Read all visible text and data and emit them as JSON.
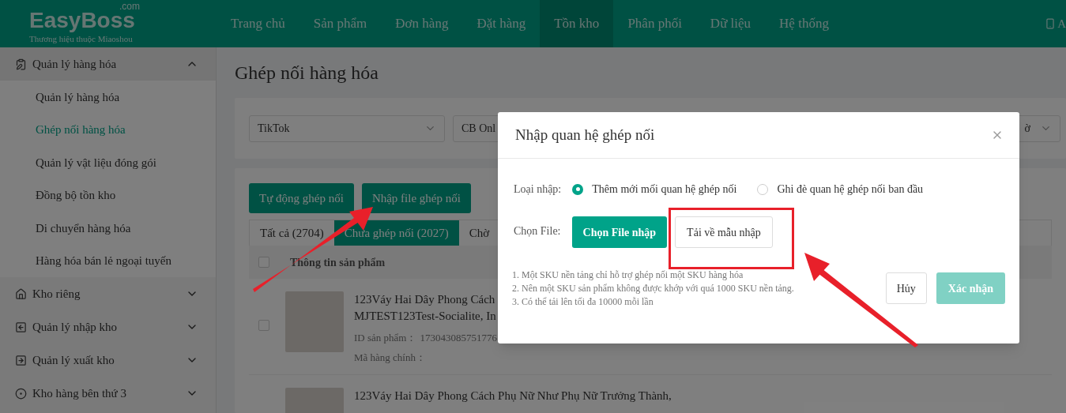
{
  "header": {
    "logo": "EasyBoss",
    "logo_suffix": ".com",
    "tagline": "Thương hiệu thuộc Miaoshou",
    "nav": [
      {
        "label": "Trang chủ",
        "selected": false
      },
      {
        "label": "Sản phẩm",
        "selected": false
      },
      {
        "label": "Đơn hàng",
        "selected": false
      },
      {
        "label": "Đặt hàng",
        "selected": false
      },
      {
        "label": "Tồn kho",
        "selected": true
      },
      {
        "label": "Phân phối",
        "selected": false
      },
      {
        "label": "Dữ liệu",
        "selected": false
      },
      {
        "label": "Hệ thống",
        "selected": false
      }
    ],
    "right_label": "A"
  },
  "sidebar": [
    {
      "kind": "clipboard",
      "label": "Quản lý hàng hóa",
      "expanded": true,
      "children": [
        {
          "label": "Quản lý hàng hóa",
          "selected": false
        },
        {
          "label": "Ghép nối hàng hóa",
          "selected": true
        },
        {
          "label": "Quản lý vật liệu đóng gói",
          "selected": false
        },
        {
          "label": "Đồng bộ tồn kho",
          "selected": false
        },
        {
          "label": "Di chuyển hàng hóa",
          "selected": false
        },
        {
          "label": "Hàng hóa bán lẻ ngoại tuyến",
          "selected": false
        }
      ]
    },
    {
      "kind": "house",
      "label": "Kho riêng",
      "expanded": false
    },
    {
      "kind": "inbound",
      "label": "Quản lý nhập kho",
      "expanded": false
    },
    {
      "kind": "outbound",
      "label": "Quản lý xuất kho",
      "expanded": false
    },
    {
      "kind": "thirdparty",
      "label": "Kho hàng bên thứ 3",
      "expanded": false
    }
  ],
  "page_title": "Ghép nối hàng hóa",
  "filters": [
    {
      "value": "TikTok"
    },
    {
      "value": "CB Onl"
    },
    {
      "value": "ờ"
    }
  ],
  "actions": [
    "Tự động ghép nối",
    "Nhập file ghép nối"
  ],
  "tabs": [
    {
      "label": "Tất cả (2704)",
      "selected": false
    },
    {
      "label": "Chưa ghép nối (2027)",
      "selected": true
    },
    {
      "label": "Chờ",
      "selected": false
    }
  ],
  "table": {
    "header_checked": false,
    "column": "Thông tin sản phẩm",
    "rows": [
      {
        "checked": false,
        "title": "123Váy Hai Dây Phong Cách",
        "title_2": "MJTEST123Test-Socialite, In",
        "id_label": "ID sản phẩm：",
        "id": "173043085751776",
        "code_label": "Mã hàng chính："
      },
      {
        "title": "123Váy Hai Dây Phong Cách Phụ Nữ Như Phụ Nữ Trưởng Thành,"
      }
    ]
  },
  "modal": {
    "title": "Nhập quan hệ ghép nối",
    "type_label": "Loại nhập:",
    "options": [
      {
        "label": "Thêm mới mối quan hệ ghép nối",
        "selected": true
      },
      {
        "label": "Ghi đè quan hệ ghép nối ban đầu",
        "selected": false
      }
    ],
    "file_label": "Chọn File:",
    "choose_button": "Chọn File nhập",
    "template_button": "Tải về mẫu nhập",
    "notes": [
      "1. Một SKU nền tảng chỉ hỗ trợ ghép nối một SKU hàng hóa",
      "2. Nên một SKU sản phẩm không được khớp với quá 1000 SKU nền tảng.",
      "3. Có thể tải lên tối đa 10000 mỗi lần"
    ],
    "cancel": "Hủy",
    "confirm": {
      "label": "Xác nhận",
      "disabled": true
    }
  }
}
